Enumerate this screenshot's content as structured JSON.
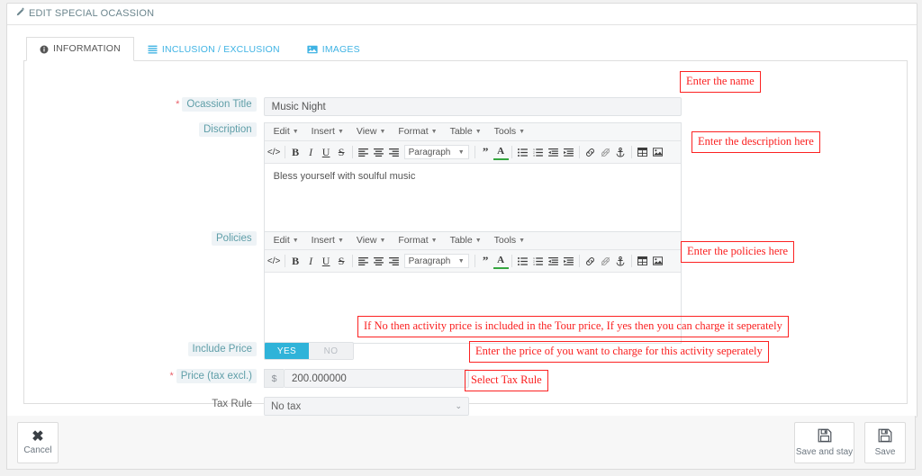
{
  "header": {
    "title": "EDIT SPECIAL OCASSION",
    "icon": "pencil-icon"
  },
  "tabs": [
    {
      "label": "INFORMATION",
      "icon": "info-circle-icon",
      "active": true
    },
    {
      "label": "INCLUSION / EXCLUSION",
      "icon": "list-icon",
      "active": false
    },
    {
      "label": "IMAGES",
      "icon": "image-icon",
      "active": false
    }
  ],
  "form": {
    "title_field": {
      "label": "Ocassion Title",
      "required": true,
      "value": "Music Night"
    },
    "description_field": {
      "label": "Discription",
      "content": "Bless yourself with soulful music"
    },
    "policies_field": {
      "label": "Policies",
      "content": ""
    },
    "include_price": {
      "label": "Include Price",
      "yes_label": "YES",
      "no_label": "NO",
      "selected": "YES"
    },
    "price_field": {
      "label": "Price (tax excl.)",
      "required": true,
      "currency": "$",
      "value": "200.000000"
    },
    "tax_rule": {
      "label": "Tax Rule",
      "selected": "No tax"
    }
  },
  "editor_toolbar": {
    "menus": [
      "Edit",
      "Insert",
      "View",
      "Format",
      "Table",
      "Tools"
    ],
    "format_select": "Paragraph",
    "buttons": [
      "source-code-icon",
      "bold-icon",
      "italic-icon",
      "underline-icon",
      "strikethrough-icon",
      "align-left-icon",
      "align-center-icon",
      "align-right-icon",
      "blockquote-icon",
      "text-color-icon",
      "bullet-list-icon",
      "numbered-list-icon",
      "outdent-icon",
      "indent-icon",
      "link-icon",
      "unlink-icon",
      "anchor-icon",
      "table-icon",
      "image-icon"
    ]
  },
  "annotations": {
    "name": "Enter the name",
    "description": "Enter the description here",
    "policies": "Enter the policies here",
    "include_price": "If No then activity price is included in the Tour price, If yes then you can charge it seperately",
    "price": "Enter the price of you want to charge for this activity seperately",
    "tax_rule": "Select Tax Rule"
  },
  "footer": {
    "cancel": {
      "label": "Cancel",
      "icon": "close-x-icon"
    },
    "save_and_stay": {
      "label": "Save and stay",
      "icon": "floppy-disk-icon"
    },
    "save": {
      "label": "Save",
      "icon": "floppy-disk-icon"
    }
  },
  "colors": {
    "accent": "#3fb3e4",
    "toggle_on": "#2fb3d9",
    "annotation": "#fa2020",
    "required": "#e8606a",
    "label": "#5f9ea8"
  }
}
